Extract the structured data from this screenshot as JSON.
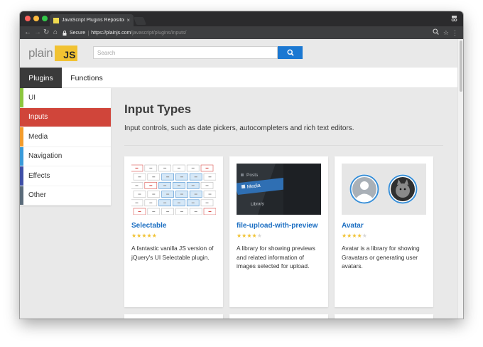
{
  "browser": {
    "tab_title": "JavaScript Plugins Repository",
    "tab_close": "×",
    "secure_label": "Secure",
    "url_host": "https://plainjs.com",
    "url_path": "/javascript/plugins/inputs/"
  },
  "site": {
    "logo_plain": "plain",
    "logo_js": "JS",
    "search_placeholder": "Search",
    "nav_tabs": [
      {
        "label": "Plugins",
        "active": true
      },
      {
        "label": "Functions",
        "active": false
      }
    ]
  },
  "sidebar": {
    "items": [
      {
        "label": "UI",
        "color": "#8cc63f",
        "active": false
      },
      {
        "label": "Inputs",
        "color": "#d0453a",
        "active": true
      },
      {
        "label": "Media",
        "color": "#f39c2d",
        "active": false
      },
      {
        "label": "Navigation",
        "color": "#3a9ad9",
        "active": false
      },
      {
        "label": "Effects",
        "color": "#3e4fa6",
        "active": false
      },
      {
        "label": "Other",
        "color": "#5a6b7a",
        "active": false
      }
    ]
  },
  "main": {
    "title": "Input Types",
    "description": "Input controls, such as date pickers, autocompleters and rich text editors.",
    "cards": [
      {
        "name": "Selectable",
        "rating": 5,
        "description": "A fantastic vanilla JS version of jQuery's UI Selectable plugin."
      },
      {
        "name": "file-upload-with-preview",
        "rating": 4,
        "description": "A library for showing previews and related information of images selected for upload."
      },
      {
        "name": "Avatar",
        "rating": 4,
        "description": "Avatar is a library for showing Gravatars or generating user avatars."
      }
    ]
  },
  "thumbnail_text": {
    "posts": "Posts",
    "media": "Media",
    "library": "Library"
  },
  "colors": {
    "accent": "#1b78d2",
    "logo_yellow": "#f1c232",
    "star": "#f1c232",
    "star_empty": "#d6d6d6"
  }
}
